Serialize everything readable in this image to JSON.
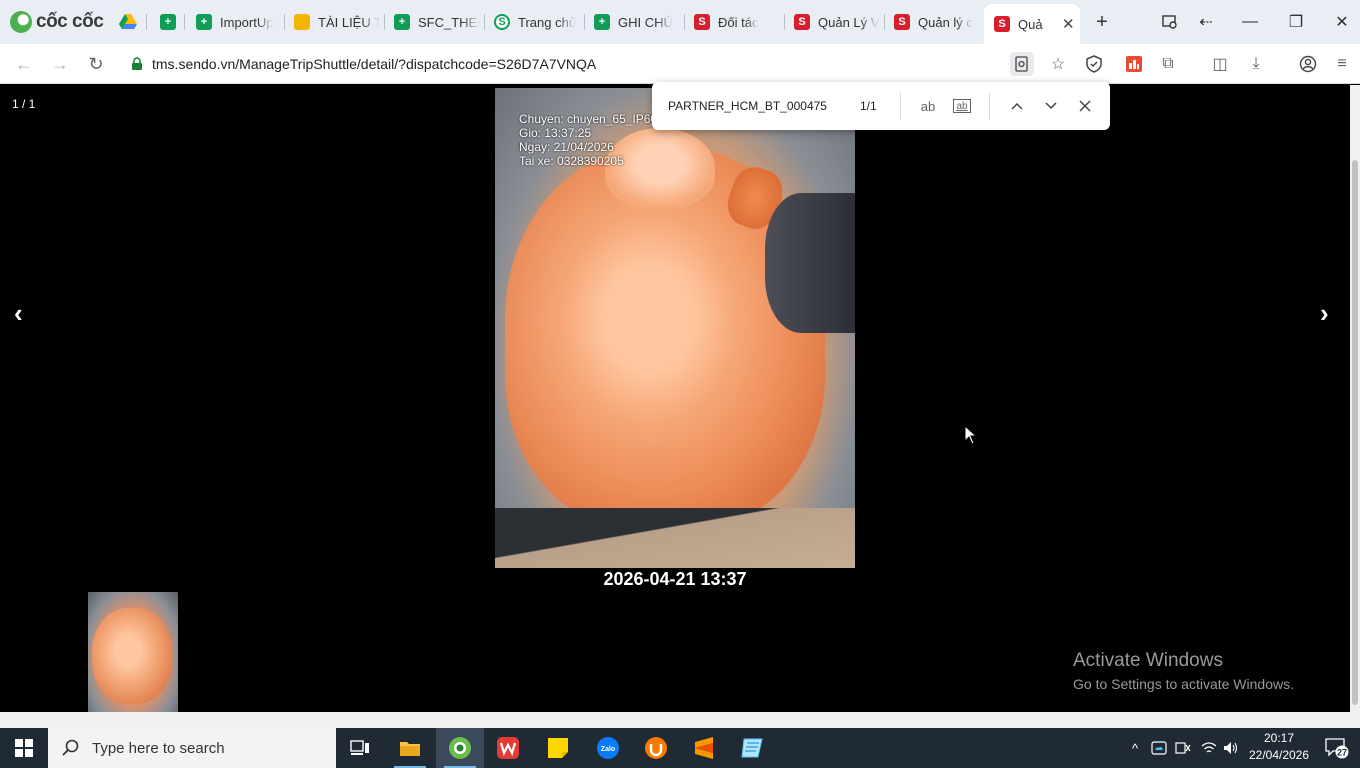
{
  "browser": {
    "brand": "cốc cốc",
    "tabs": [
      {
        "title": "ImportUp",
        "favicon": "sheet-icon"
      },
      {
        "title": "TÀI LIỆU T",
        "favicon": "slide-icon"
      },
      {
        "title": "SFC_THEC",
        "favicon": "sheet-icon"
      },
      {
        "title": "Trang chủ",
        "favicon": "green-circle-icon"
      },
      {
        "title": "GHI CHÚ",
        "favicon": "sheet-icon"
      },
      {
        "title": "Đối tác",
        "favicon": "sendo-icon"
      },
      {
        "title": "Quản Lý V",
        "favicon": "sendo-icon"
      },
      {
        "title": "Quản lý c",
        "favicon": "sendo-icon"
      },
      {
        "title": "Quả",
        "favicon": "sendo-icon",
        "active": true
      }
    ],
    "url": "tms.sendo.vn/ManageTripShuttle/detail/?dispatchcode=S26D7A7VNQA"
  },
  "find_bar": {
    "query": "PARTNER_HCM_BT_000475",
    "count": "1/1",
    "match_case_label": "ab",
    "whole_word_label": "ab"
  },
  "viewer": {
    "counter": "1 / 1",
    "prev_arrow": "‹",
    "next_arrow": "›",
    "photo_overlay": {
      "line1": "Chuyen: chuyen_65_IP60",
      "line2": "Gio: 13:37:25",
      "line3": "Ngay: 21/04/2026",
      "line4": "Tai xe: 0328390205"
    },
    "caption": "2026-04-21 13:37"
  },
  "watermark": {
    "title": "Activate Windows",
    "subtitle": "Go to Settings to activate Windows."
  },
  "taskbar": {
    "search_placeholder": "Type here to search",
    "time": "20:17",
    "date": "22/04/2026",
    "notifications": "27",
    "apps": [
      "task-view-icon",
      "file-explorer-icon",
      "coccoc-browser-icon",
      "wps-icon",
      "sticky-notes-icon",
      "zalo-icon",
      "ultraviewer-icon",
      "sublime-icon",
      "app-icon"
    ]
  },
  "colors": {
    "tabstrip_bg": "#e9eef5",
    "sendo_red": "#d81e2c",
    "sheets_green": "#0f9d58",
    "taskbar_bg": "#1f2a35"
  }
}
